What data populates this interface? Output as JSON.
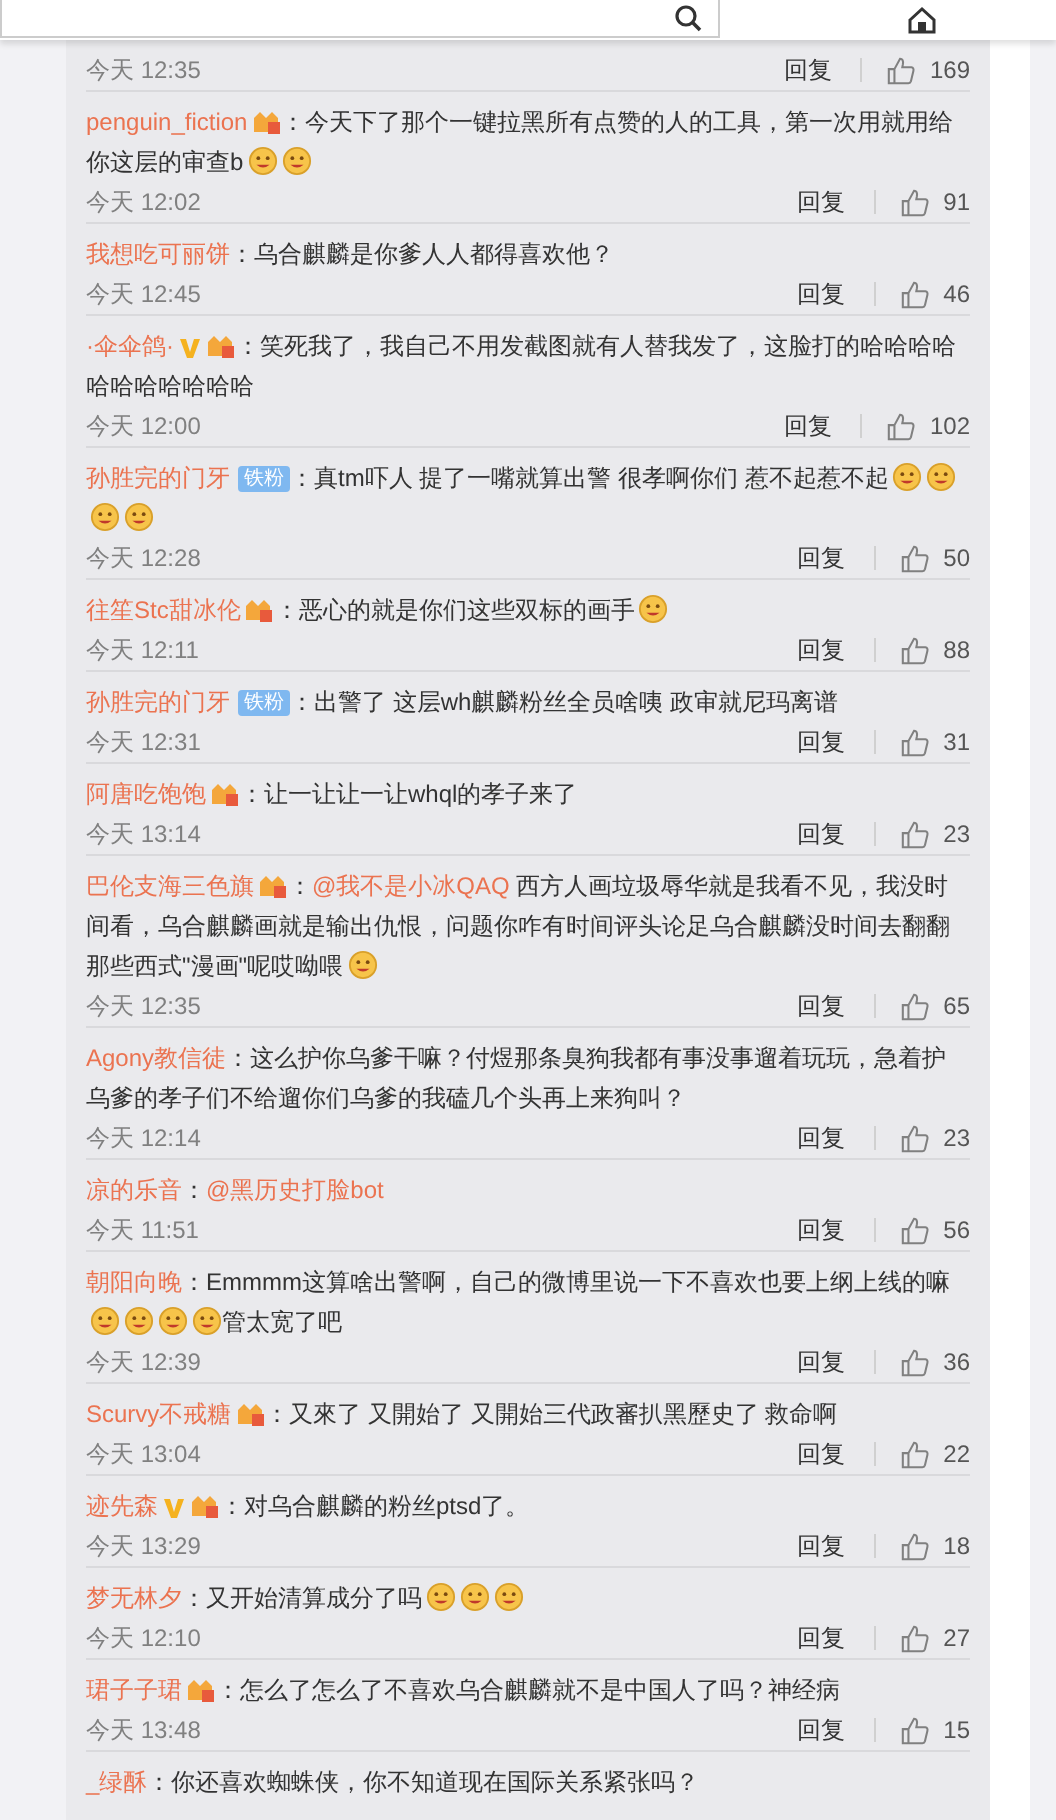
{
  "search": {
    "kind": "search"
  },
  "comments": [
    {
      "time": "今天 12:35",
      "reply": "回复",
      "likes": "169"
    },
    {
      "user": "penguin_fiction",
      "badges": [
        {
          "kind": "crown"
        }
      ],
      "parts": [
        {
          "kind": "text",
          "text": "：今天下了那个一键拉黑所有点赞的人的工具，第一次用就用给你这层的审查b"
        },
        {
          "kind": "emoji"
        },
        {
          "kind": "emoji"
        }
      ],
      "time": "今天 12:02",
      "reply": "回复",
      "likes": "91"
    },
    {
      "user": "我想吃可丽饼",
      "parts": [
        {
          "kind": "text",
          "text": "：乌合麒麟是你爹人人都得喜欢他？"
        }
      ],
      "time": "今天 12:45",
      "reply": "回复",
      "likes": "46"
    },
    {
      "user": "·伞伞鸽·",
      "badges": [
        {
          "kind": "v"
        },
        {
          "kind": "crown"
        }
      ],
      "parts": [
        {
          "kind": "text",
          "text": "：笑死我了，我自己不用发截图就有人替我发了，这脸打的哈哈哈哈哈哈哈哈哈哈哈"
        }
      ],
      "time": "今天 12:00",
      "reply": "回复",
      "likes": "102"
    },
    {
      "user": "孙胜完的门牙",
      "badges": [
        {
          "kind": "fan",
          "label": "铁粉"
        }
      ],
      "parts": [
        {
          "kind": "text",
          "text": "：真tm吓人 提了一嘴就算出警 很孝啊你们 惹不起惹不起"
        },
        {
          "kind": "emoji"
        },
        {
          "kind": "emoji"
        },
        {
          "kind": "emoji"
        },
        {
          "kind": "emoji"
        }
      ],
      "time": "今天 12:28",
      "reply": "回复",
      "likes": "50"
    },
    {
      "user": "往笙Stc甜冰伦",
      "badges": [
        {
          "kind": "crown"
        }
      ],
      "parts": [
        {
          "kind": "text",
          "text": "：恶心的就是你们这些双标的画手"
        },
        {
          "kind": "emoji"
        }
      ],
      "time": "今天 12:11",
      "reply": "回复",
      "likes": "88"
    },
    {
      "user": "孙胜完的门牙",
      "badges": [
        {
          "kind": "fan",
          "label": "铁粉"
        }
      ],
      "parts": [
        {
          "kind": "text",
          "text": "：出警了 这层wh麒麟粉丝全员啥咦 政审就尼玛离谱"
        }
      ],
      "time": "今天 12:31",
      "reply": "回复",
      "likes": "31"
    },
    {
      "user": "阿唐吃饱饱",
      "badges": [
        {
          "kind": "crown"
        }
      ],
      "parts": [
        {
          "kind": "text",
          "text": "：让一让让一让whql的孝子来了"
        }
      ],
      "time": "今天 13:14",
      "reply": "回复",
      "likes": "23"
    },
    {
      "user": "巴伦支海三色旗",
      "badges": [
        {
          "kind": "crown"
        }
      ],
      "parts": [
        {
          "kind": "text",
          "text": "："
        },
        {
          "kind": "mention",
          "text": "@我不是小冰QAQ"
        },
        {
          "kind": "text",
          "text": " 西方人画垃圾辱华就是我看不见，我没时间看，乌合麒麟画就是输出仇恨，问题你咋有时间评头论足乌合麒麟没时间去翻翻那些西式\"漫画\"呢哎呦喂"
        },
        {
          "kind": "emoji"
        }
      ],
      "time": "今天 12:35",
      "reply": "回复",
      "likes": "65"
    },
    {
      "user": "Agony教信徒",
      "parts": [
        {
          "kind": "text",
          "text": "：这么护你乌爹干嘛？付煜那条臭狗我都有事没事遛着玩玩，急着护乌爹的孝子们不给遛你们乌爹的我磕几个头再上来狗叫？"
        }
      ],
      "time": "今天 12:14",
      "reply": "回复",
      "likes": "23"
    },
    {
      "user": "凉的乐音",
      "parts": [
        {
          "kind": "text",
          "text": "："
        },
        {
          "kind": "mention",
          "text": "@黑历史打脸bot"
        }
      ],
      "time": "今天 11:51",
      "reply": "回复",
      "likes": "56"
    },
    {
      "user": "朝阳向晚",
      "parts": [
        {
          "kind": "text",
          "text": "：Emmmm这算啥出警啊，自己的微博里说一下不喜欢也要上纲上线的嘛"
        },
        {
          "kind": "emoji"
        },
        {
          "kind": "emoji"
        },
        {
          "kind": "emoji"
        },
        {
          "kind": "emoji"
        },
        {
          "kind": "text",
          "text": "管太宽了吧"
        }
      ],
      "time": "今天 12:39",
      "reply": "回复",
      "likes": "36"
    },
    {
      "user": "Scurvy不戒糖",
      "badges": [
        {
          "kind": "crown"
        }
      ],
      "parts": [
        {
          "kind": "text",
          "text": "：又來了 又開始了 又開始三代政審扒黑歷史了 救命啊"
        }
      ],
      "time": "今天 13:04",
      "reply": "回复",
      "likes": "22"
    },
    {
      "user": "迹先森",
      "badges": [
        {
          "kind": "v"
        },
        {
          "kind": "crown"
        }
      ],
      "parts": [
        {
          "kind": "text",
          "text": "：对乌合麒麟的粉丝ptsd了。"
        }
      ],
      "time": "今天 13:29",
      "reply": "回复",
      "likes": "18"
    },
    {
      "user": "梦无林夕",
      "parts": [
        {
          "kind": "text",
          "text": "：又开始清算成分了吗"
        },
        {
          "kind": "emoji"
        },
        {
          "kind": "emoji"
        },
        {
          "kind": "emoji"
        }
      ],
      "time": "今天 12:10",
      "reply": "回复",
      "likes": "27"
    },
    {
      "user": "珺子子珺",
      "badges": [
        {
          "kind": "crown"
        }
      ],
      "parts": [
        {
          "kind": "text",
          "text": "：怎么了怎么了不喜欢乌合麒麟就不是中国人了吗？神经病"
        }
      ],
      "time": "今天 13:48",
      "reply": "回复",
      "likes": "15"
    },
    {
      "user": "_绿酥",
      "parts": [
        {
          "kind": "text",
          "text": "：你还喜欢蜘蛛侠，你不知道现在国际关系紧张吗？"
        }
      ]
    }
  ]
}
